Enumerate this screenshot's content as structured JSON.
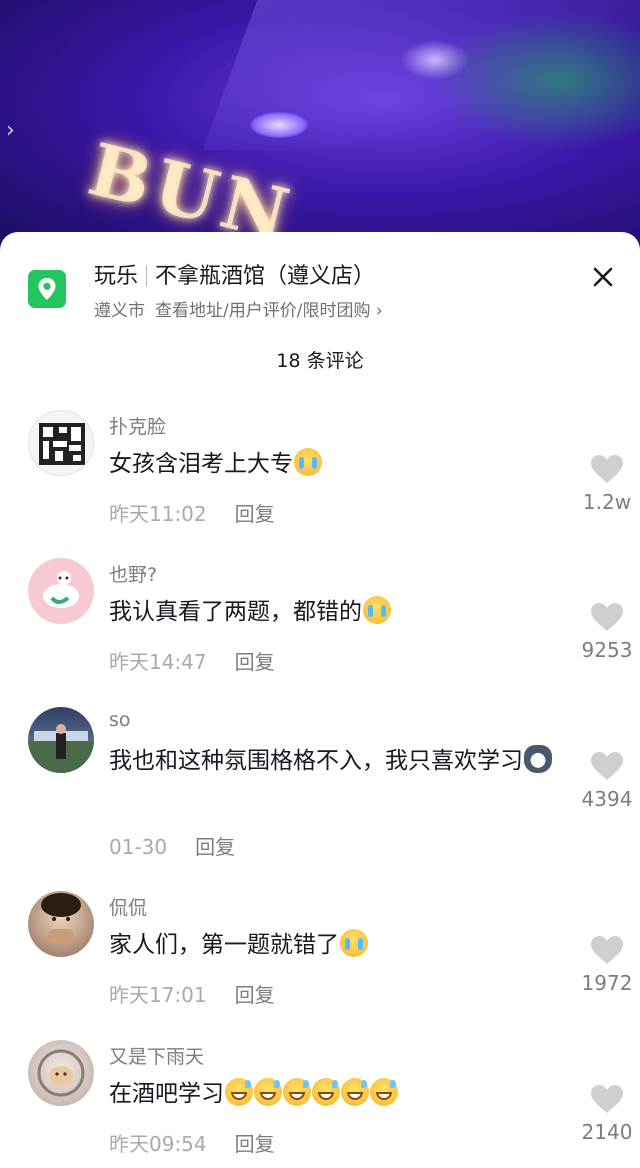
{
  "location": {
    "category": "玩乐",
    "name": "不拿瓶酒馆（遵义店）",
    "city": "遵义市",
    "links": "查看地址/用户评价/限时团购",
    "chevron": "›",
    "icon": "location-pin-icon",
    "accent": "#23c55e"
  },
  "video": {
    "back_chevron": "›"
  },
  "comment_count": "18 条评论",
  "comments": [
    {
      "user": "扑克脸",
      "text": "女孩含泪考上大专",
      "emoji": "crying-face-emoji",
      "time": "昨天11:02",
      "reply": "回复",
      "likes": "1.2w"
    },
    {
      "user": "也野?",
      "text": "我认真看了两题，都错的",
      "emoji": "crying-face-emoji",
      "time": "昨天14:47",
      "reply": "回复",
      "likes": "9253"
    },
    {
      "user": "so",
      "text": "我也和这种氛围格格不入，我只喜欢学习",
      "emoji": "husky-emoji",
      "time": "01-30",
      "reply": "回复",
      "likes": "4394"
    },
    {
      "user": "侃侃",
      "text": "家人们，第一题就错了",
      "emoji": "crying-face-emoji",
      "time": "昨天17:01",
      "reply": "回复",
      "likes": "1972"
    },
    {
      "user": "又是下雨天",
      "text": "在酒吧学习",
      "emoji": "grinning-sweat-emoji",
      "time": "昨天09:54",
      "reply": "回复",
      "likes": "2140"
    }
  ]
}
